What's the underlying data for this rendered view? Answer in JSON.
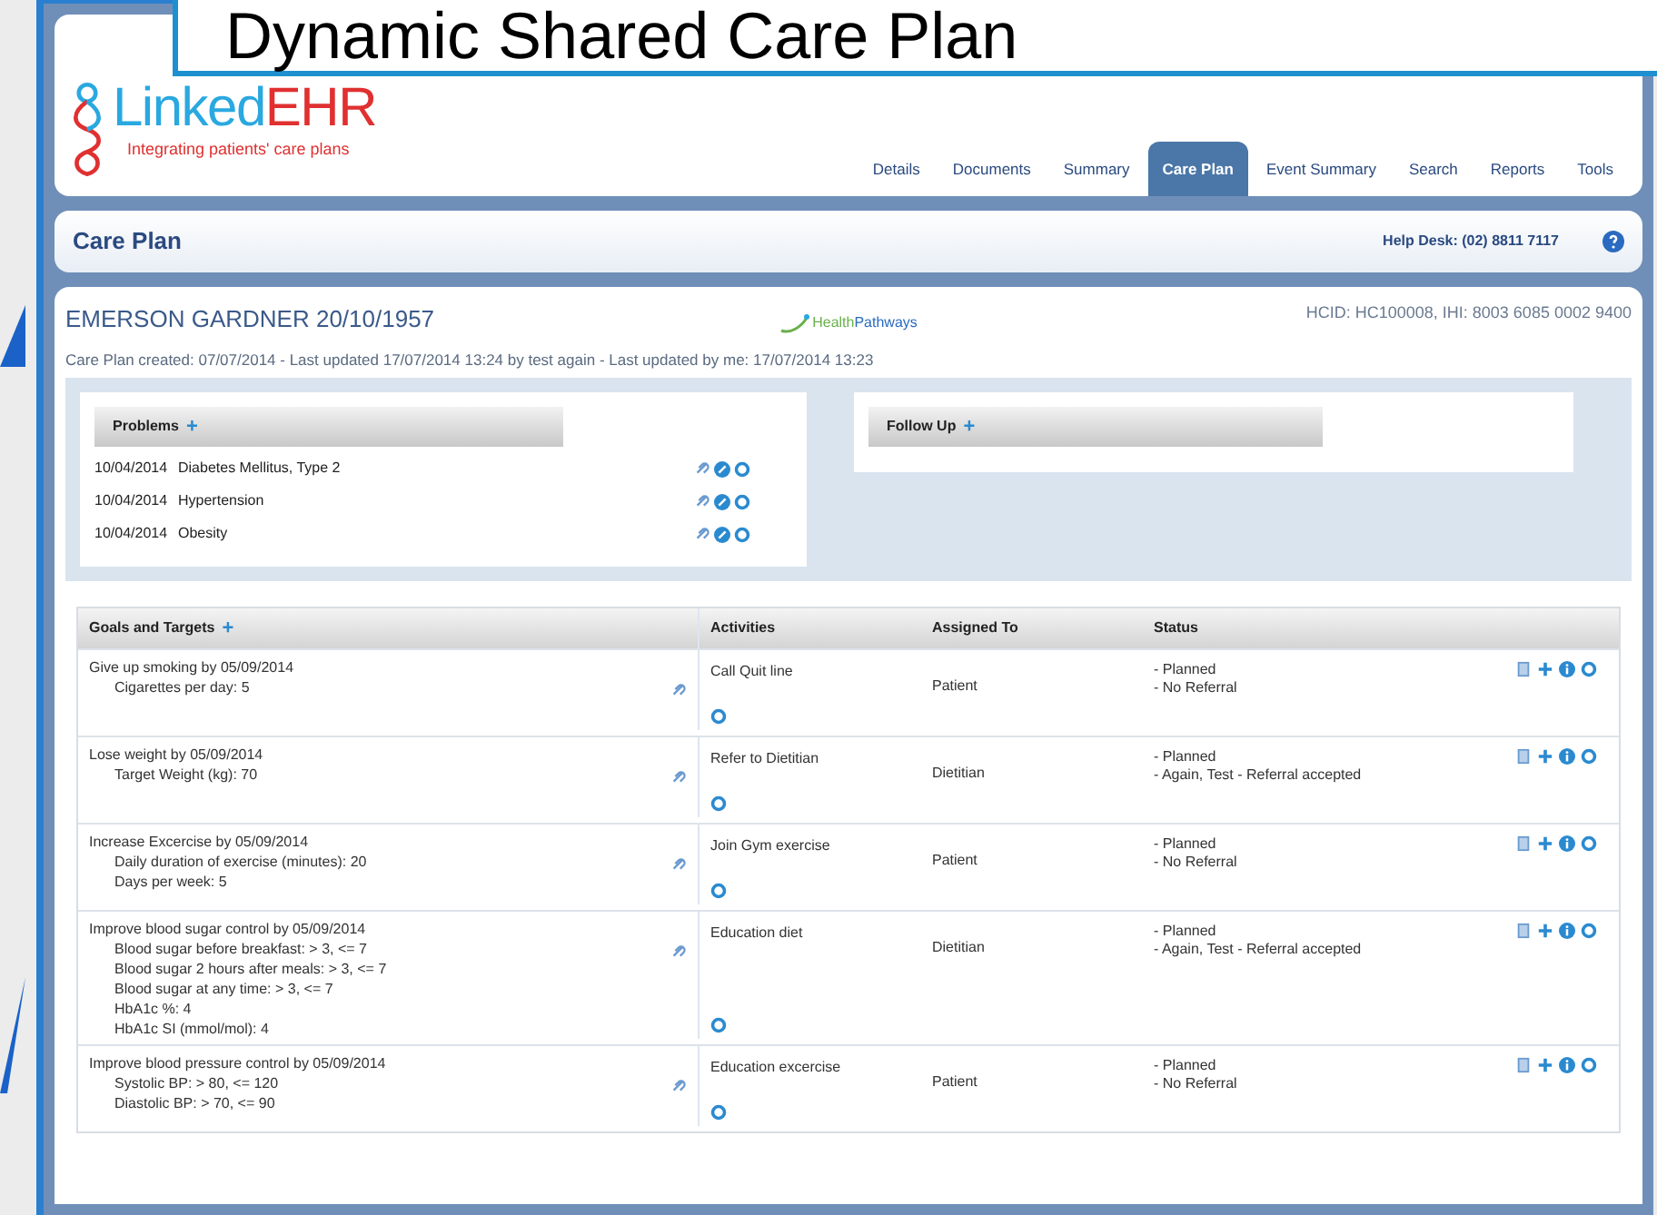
{
  "slide_title": "Dynamic Shared Care Plan",
  "logo": {
    "name_part1": "Linked",
    "name_part2": "EHR",
    "tagline": "Integrating patients' care plans"
  },
  "nav_tabs": [
    {
      "label": "Details",
      "selected": false
    },
    {
      "label": "Documents",
      "selected": false
    },
    {
      "label": "Summary",
      "selected": false
    },
    {
      "label": "Care Plan",
      "selected": true
    },
    {
      "label": "Event Summary",
      "selected": false
    },
    {
      "label": "Search",
      "selected": false
    },
    {
      "label": "Reports",
      "selected": false
    },
    {
      "label": "Tools",
      "selected": false
    }
  ],
  "page_bar": {
    "title": "Care Plan",
    "help_desk": "Help Desk: (02) 8811 7117"
  },
  "patient": {
    "name": "EMERSON GARDNER 20/10/1957",
    "pathways_logo": {
      "part1": "Health",
      "part2": "Pathways"
    },
    "ids": "HCID: HC100008, IHI: 8003 6085 0002 9400",
    "care_plan_info": "Care Plan created: 07/07/2014 - Last updated 17/07/2014 13:24 by test again - Last updated by me: 17/07/2014 13:23"
  },
  "problems": {
    "title": "Problems",
    "add_symbol": "+",
    "items": [
      {
        "date": "10/04/2014",
        "name": "Diabetes Mellitus, Type 2"
      },
      {
        "date": "10/04/2014",
        "name": "Hypertension"
      },
      {
        "date": "10/04/2014",
        "name": "Obesity"
      }
    ]
  },
  "follow_up": {
    "title": "Follow Up",
    "add_symbol": "+"
  },
  "goals_table": {
    "add_symbol": "+",
    "columns": [
      "Goals and Targets",
      "Activities",
      "Assigned To",
      "Status"
    ],
    "rows": [
      {
        "goal": "Give up smoking by 05/09/2014",
        "targets": [
          "Cigarettes per day: 5"
        ],
        "activity": "Call Quit line",
        "assigned_to": "Patient",
        "status": [
          "- Planned",
          "- No Referral"
        ]
      },
      {
        "goal": "Lose weight by 05/09/2014",
        "targets": [
          "Target Weight (kg): 70"
        ],
        "activity": "Refer to Dietitian",
        "assigned_to": "Dietitian",
        "status": [
          "- Planned",
          "- Again, Test - Referral accepted"
        ]
      },
      {
        "goal": "Increase Excercise by 05/09/2014",
        "targets": [
          "Daily duration of exercise (minutes): 20",
          "Days per week: 5"
        ],
        "activity": "Join Gym exercise",
        "assigned_to": "Patient",
        "status": [
          "- Planned",
          "- No Referral"
        ]
      },
      {
        "goal": "Improve blood sugar control by 05/09/2014",
        "targets": [
          "Blood sugar before breakfast: > 3, <= 7",
          "Blood sugar 2 hours after meals: > 3, <= 7",
          "Blood sugar at any time: > 3, <= 7",
          "HbA1c %: 4",
          "HbA1c SI (mmol/mol): 4"
        ],
        "activity": "Education diet",
        "assigned_to": "Dietitian",
        "status": [
          "- Planned",
          "- Again, Test - Referral accepted"
        ]
      },
      {
        "goal": "Improve blood pressure control by 05/09/2014",
        "targets": [
          "Systolic BP: > 80, <= 120",
          "Diastolic BP: > 70, <= 90"
        ],
        "activity": "Education excercise",
        "assigned_to": "Patient",
        "status": [
          "- Planned",
          "- No Referral"
        ]
      }
    ]
  }
}
